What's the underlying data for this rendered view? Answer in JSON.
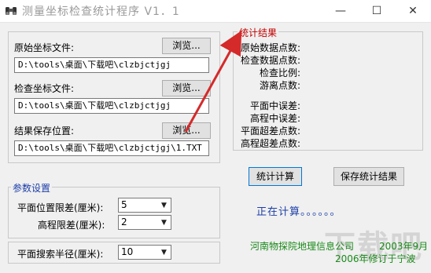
{
  "window": {
    "title": "测量坐标检查统计程序 V1．1",
    "min_symbol": "—",
    "max_symbol": "☐",
    "close_symbol": "✕"
  },
  "files": {
    "original_label": "原始坐标文件:",
    "original_value": "D:\\tools\\桌面\\下载吧\\clzbjctjgj",
    "check_label": "检查坐标文件:",
    "check_value": "D:\\tools\\桌面\\下载吧\\clzbjctjgj",
    "result_label": "结果保存位置:",
    "result_value": "D:\\tools\\桌面\\下载吧\\clzbjctjgj\\1.TXT",
    "browse_label": "浏览..."
  },
  "params": {
    "group_title": "参数设置",
    "plane_tol_label": "平面位置限差(厘米):",
    "plane_tol_value": "5",
    "height_tol_label": "高程限差(厘米):",
    "height_tol_value": "2",
    "radius_label": "平面搜索半径(厘米):",
    "radius_value": "10"
  },
  "stats": {
    "group_title": "统计结果",
    "items": [
      "原始数据点数:",
      "检查数据点数:",
      "检查比例:",
      "游离点数:",
      "平面中误差:",
      "高程中误差:",
      "平面超差点数:",
      "高程超差点数:"
    ]
  },
  "actions": {
    "calc_label": "统计计算",
    "save_label": "保存统计结果"
  },
  "status": "正在计算。。。。。。",
  "footer": {
    "company": "河南物探院地理信息公司",
    "date1": "2003年9月",
    "date2": "2006年修订于宁波"
  },
  "watermark": "下载吧",
  "colors": {
    "arrow": "#d42a2a",
    "status": "#1c3ea8",
    "footer": "#1a8a1a",
    "stats_title": "#c00000",
    "params_title": "#1c3ea8"
  },
  "icons": {
    "app": "binoculars-icon"
  }
}
